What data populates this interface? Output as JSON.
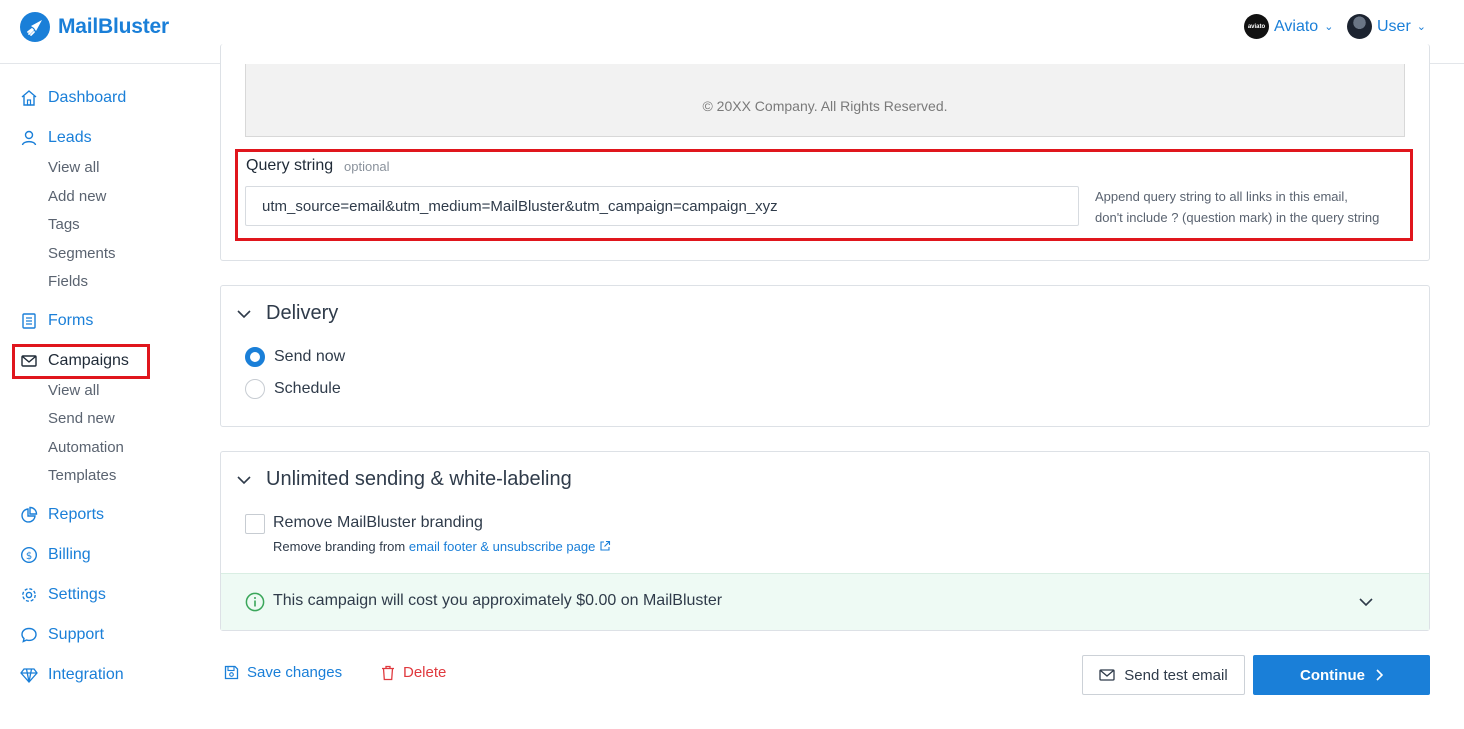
{
  "app": {
    "name": "MailBluster"
  },
  "header": {
    "workspace": "Aviato",
    "workspace_avatar_text": "aviato",
    "user": "User"
  },
  "sidebar": {
    "dashboard": "Dashboard",
    "leads": "Leads",
    "leads_sub": [
      "View all",
      "Add new",
      "Tags",
      "Segments",
      "Fields"
    ],
    "forms": "Forms",
    "campaigns": "Campaigns",
    "campaigns_sub": [
      "View all",
      "Send new",
      "Automation",
      "Templates"
    ],
    "reports": "Reports",
    "billing": "Billing",
    "settings": "Settings",
    "support": "Support",
    "integration": "Integration"
  },
  "email_preview": {
    "footer_text": "© 20XX Company. All Rights Reserved."
  },
  "query_string": {
    "label": "Query string",
    "optional": "optional",
    "value": "utm_source=email&utm_medium=MailBluster&utm_campaign=campaign_xyz",
    "help_line1": "Append query string to all links in this email,",
    "help_line2": "don't include ? (question mark) in the query string"
  },
  "delivery": {
    "title": "Delivery",
    "options": [
      "Send now",
      "Schedule"
    ],
    "selected": "Send now"
  },
  "white_label": {
    "title": "Unlimited sending & white-labeling",
    "checkbox_label": "Remove MailBluster branding",
    "sub_prefix": "Remove branding from",
    "sub_link": "email footer & unsubscribe page",
    "checked": false
  },
  "cost": {
    "text": "This campaign will cost you approximately $0.00 on MailBluster"
  },
  "actions": {
    "save": "Save changes",
    "delete": "Delete",
    "send_test": "Send test email",
    "continue": "Continue"
  },
  "colors": {
    "accent": "#1a7fd8",
    "highlight": "#e0161d",
    "danger": "#e0393e",
    "success_bg": "#eefaf4"
  }
}
